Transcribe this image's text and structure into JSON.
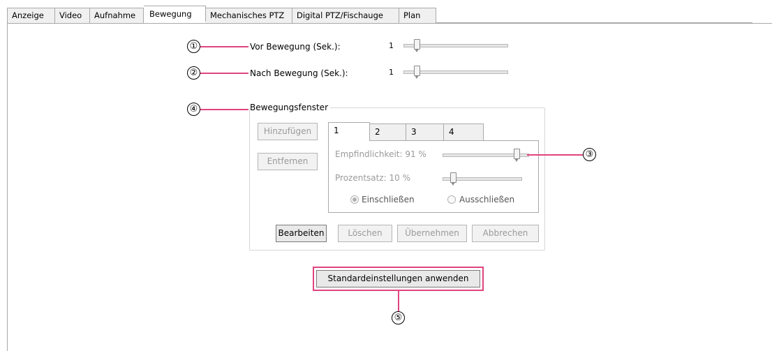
{
  "tabs": [
    "Anzeige",
    "Video",
    "Aufnahme",
    "Bewegung",
    "Mechanisches PTZ",
    "Digital PTZ/Fischauge",
    "Plan"
  ],
  "active_tab": "Bewegung",
  "pre_motion": {
    "label": "Vor Bewegung (Sek.):",
    "value": "1"
  },
  "post_motion": {
    "label": "Nach Bewegung (Sek.):",
    "value": "1"
  },
  "motion_window": {
    "title": "Bewegungsfenster",
    "add_label": "Hinzufügen",
    "remove_label": "Entfernen",
    "window_tabs": [
      "1",
      "2",
      "3",
      "4"
    ],
    "active_window_tab": "1",
    "sensitivity_label": "Empfindlichkeit: 91 %",
    "sensitivity_value": 91,
    "percentage_label": "Prozentsatz: 10 %",
    "percentage_value": 10,
    "include_label": "Einschließen",
    "exclude_label": "Ausschließen",
    "include_checked": true,
    "edit_label": "Bearbeiten",
    "delete_label": "Löschen",
    "apply_label": "Übernehmen",
    "cancel_label": "Abbrechen"
  },
  "defaults_button": "Standardeinstellungen anwenden",
  "callouts": [
    "①",
    "②",
    "③",
    "④",
    "⑤"
  ],
  "colors": {
    "callout_line": "#e0447e",
    "tab_border": "#a9a9a9"
  }
}
